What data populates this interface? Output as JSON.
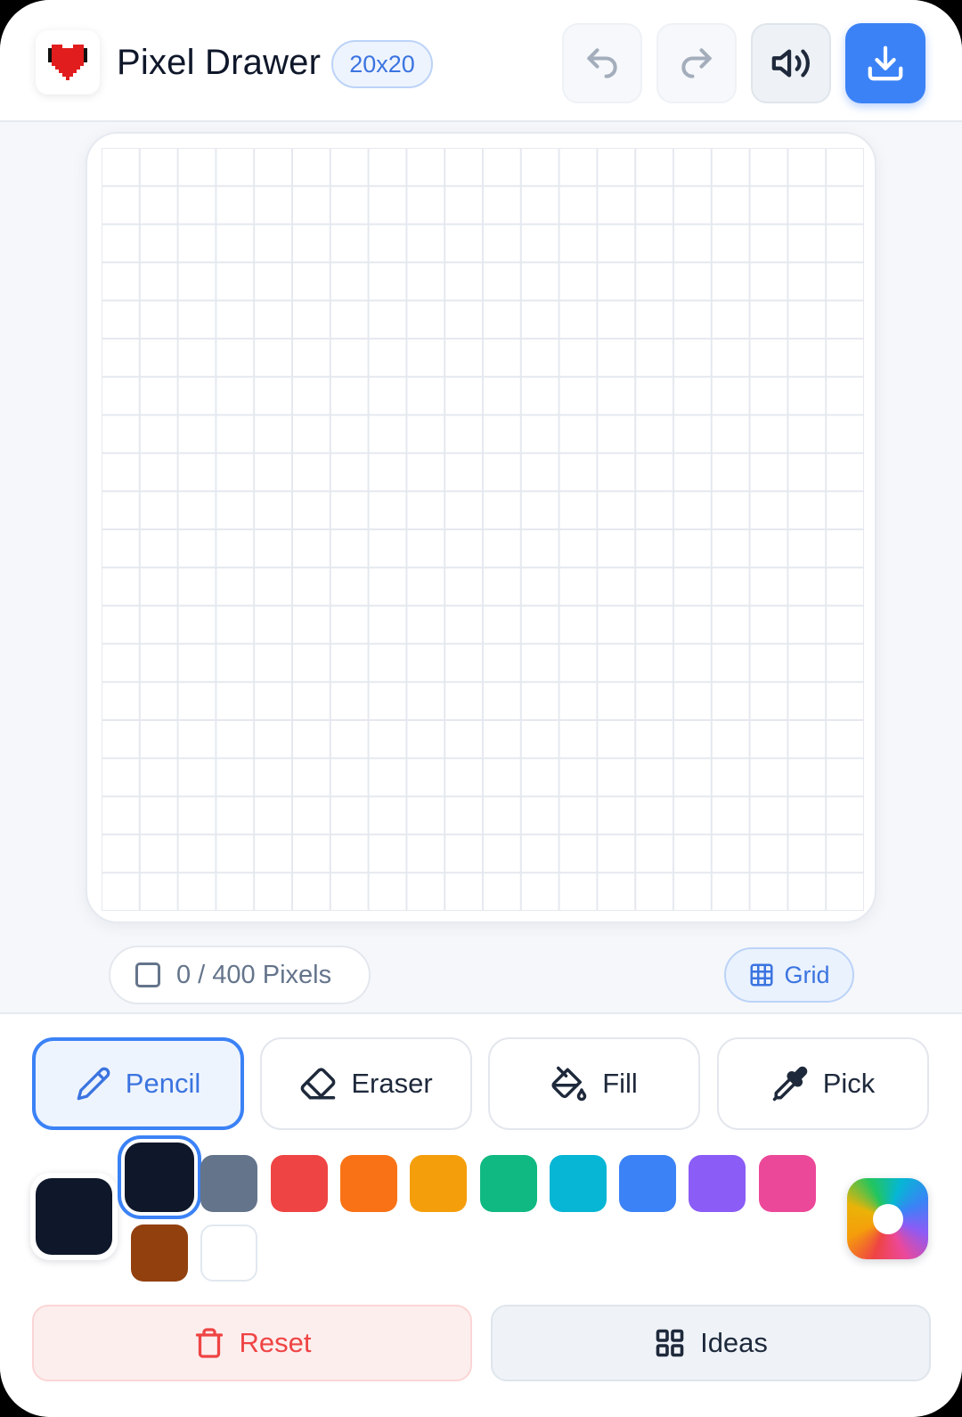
{
  "header": {
    "title": "Pixel Drawer",
    "size_badge": "20x20",
    "logo_icon": "heart-pixel-icon"
  },
  "canvas": {
    "columns": 20,
    "rows": 20,
    "pixel_count": "0 / 400 Pixels",
    "grid_toggle_label": "Grid"
  },
  "tools": [
    {
      "id": "pencil",
      "label": "Pencil",
      "icon": "pencil-icon",
      "active": true
    },
    {
      "id": "eraser",
      "label": "Eraser",
      "icon": "eraser-icon",
      "active": false
    },
    {
      "id": "fill",
      "label": "Fill",
      "icon": "paint-bucket-icon",
      "active": false
    },
    {
      "id": "pick",
      "label": "Pick",
      "icon": "eyedropper-icon",
      "active": false
    }
  ],
  "palette": {
    "current": "#0f172a",
    "selected_index": 0,
    "colors": [
      "#0f172a",
      "#64748b",
      "#ef4444",
      "#f97316",
      "#f59e0b",
      "#10b981",
      "#06b6d4",
      "#3b82f6",
      "#8b5cf6",
      "#ec4899",
      "#92400e",
      "#ffffff"
    ]
  },
  "actions": {
    "reset_label": "Reset",
    "ideas_label": "Ideas"
  },
  "colors": {
    "accent": "#3b82f6",
    "danger": "#ef4444"
  }
}
